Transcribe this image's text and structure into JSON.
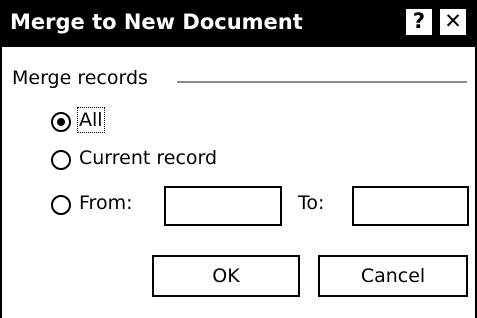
{
  "window": {
    "title": "Merge to New Document",
    "help_glyph": "?",
    "close_glyph": "✕"
  },
  "merge_records": {
    "label": "Merge records",
    "options": [
      {
        "label": "All",
        "selected": true
      },
      {
        "label": "Current record",
        "selected": false
      },
      {
        "label": "From:",
        "selected": false
      }
    ],
    "to_label": "To:",
    "from_value": "",
    "to_value": ""
  },
  "buttons": {
    "ok": "OK",
    "cancel": "Cancel"
  }
}
